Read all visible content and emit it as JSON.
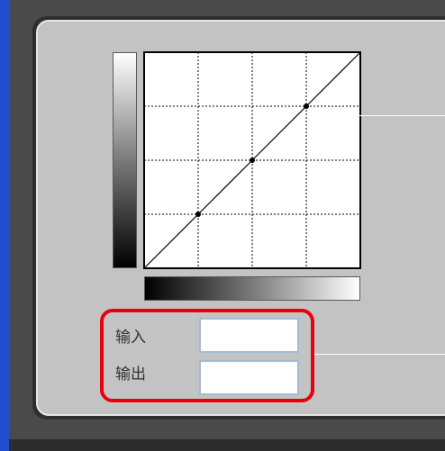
{
  "tone_curve": {
    "control_points": [
      {
        "input": 64,
        "output": 64
      },
      {
        "input": 128,
        "output": 128
      },
      {
        "input": 192,
        "output": 192
      }
    ],
    "grid_divisions": 4
  },
  "fields": {
    "input_label": "输入",
    "output_label": "输出",
    "input_value": "",
    "output_value": ""
  },
  "colors": {
    "highlight": "#e8000e",
    "panel": "#c3c3c3",
    "field_border": "#a3bbd6"
  }
}
